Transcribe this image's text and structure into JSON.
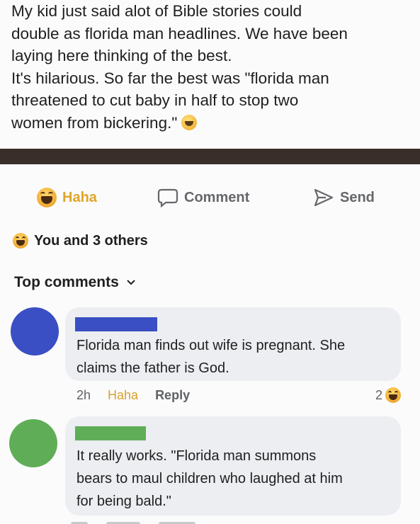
{
  "post": {
    "lines": [
      "My kid just said alot of Bible stories could",
      "double as florida man headlines. We have been",
      "laying here thinking of the best.",
      "It's hilarious. So far the best was \"florida man",
      "threatened to cut baby in half to stop two",
      "women from bickering.\""
    ],
    "emoji_icon": "grinning-sweat-emoji"
  },
  "actions": {
    "haha_label": "Haha",
    "comment_label": "Comment",
    "send_label": "Send"
  },
  "reactions": {
    "summary": "You and 3 others"
  },
  "comments_header": {
    "label": "Top comments"
  },
  "comments": [
    {
      "avatar_color": "#3a4fc4",
      "name_bar_color": "#3a4fc4",
      "lines": [
        "Florida man finds out wife is pregnant. She",
        "claims the father is God."
      ],
      "time": "2h",
      "haha_label": "Haha",
      "reply_label": "Reply",
      "reaction_count": "2"
    },
    {
      "avatar_color": "#5fae57",
      "name_bar_color": "#5fae57",
      "lines": [
        "It really works. \"Florida man summons",
        "bears to maul children who laughed at him",
        "for being bald.\""
      ]
    }
  ],
  "colors": {
    "haha_yellow": "#e0a42b",
    "muted_text": "#65676b",
    "bubble_bg": "#eceef1",
    "divider_bar": "#3a2e2a"
  }
}
